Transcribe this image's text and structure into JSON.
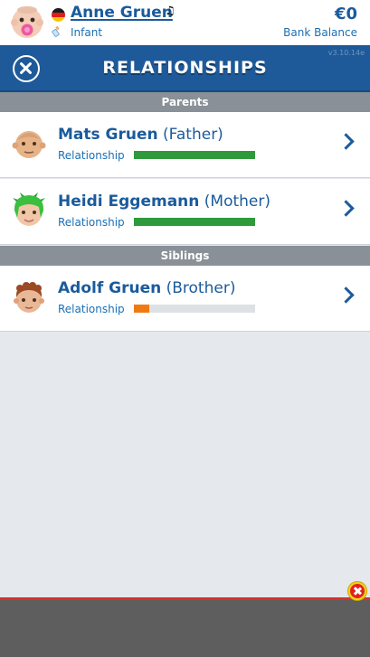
{
  "status_bar": {
    "character_name": "Anne Gruen",
    "life_stage": "Infant",
    "money": "€0",
    "money_label": "Bank Balance",
    "music_icon": "♫"
  },
  "header": {
    "title": "RELATIONSHIPS",
    "version": "v3.10.14e"
  },
  "sections": {
    "parents_label": "Parents",
    "siblings_label": "Siblings"
  },
  "relationships": [
    {
      "name": "Mats Gruen",
      "relation": "(Father)",
      "label": "Relationship",
      "level": 1.0,
      "color": "#2e9a3c"
    },
    {
      "name": "Heidi Eggemann",
      "relation": "(Mother)",
      "label": "Relationship",
      "level": 1.0,
      "color": "#2e9a3c"
    },
    {
      "name": "Adolf Gruen",
      "relation": "(Brother)",
      "label": "Relationship",
      "level": 0.13,
      "color": "#f07a12"
    }
  ],
  "colors": {
    "brand_blue": "#1e5a99",
    "positive": "#2e9a3c",
    "low": "#f07a12"
  }
}
